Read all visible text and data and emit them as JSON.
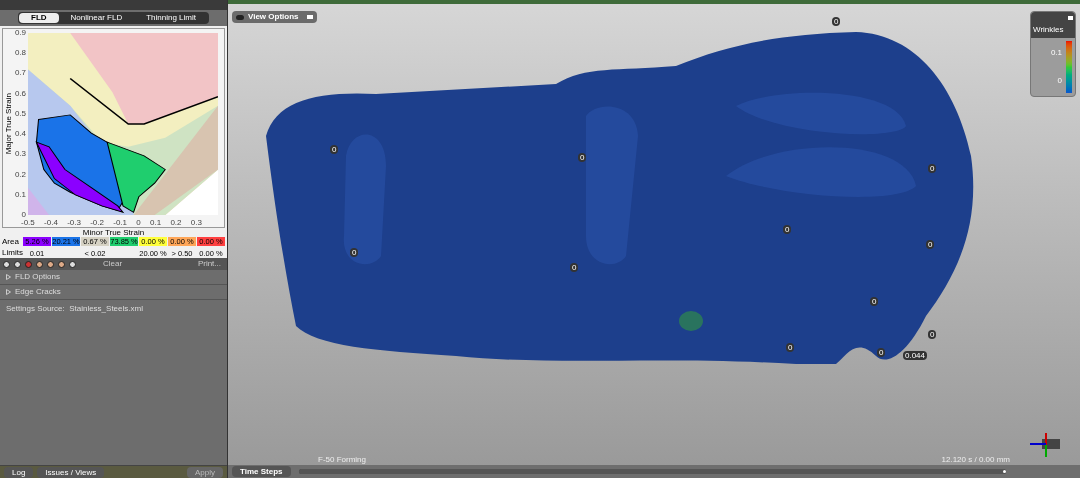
{
  "fld_panel": {
    "tabs": [
      {
        "label": "FLD",
        "selected": true
      },
      {
        "label": "Nonlinear FLD",
        "selected": false
      },
      {
        "label": "Thinning Limit",
        "selected": false
      }
    ],
    "y_axis_label": "Major True Strain",
    "x_axis_label": "Minor True Strain",
    "y_ticks": [
      "0.9",
      "0.8",
      "0.7",
      "0.6",
      "0.5",
      "0.4",
      "0.3",
      "0.2",
      "0.1",
      "0"
    ],
    "x_ticks": [
      "-0.5",
      "-0.4",
      "-0.3",
      "-0.2",
      "-0.1",
      "0",
      "0.1",
      "0.2",
      "0.3"
    ],
    "area_label": "Area",
    "limits_label": "Limits",
    "zones": [
      {
        "area": "5.26 %",
        "limit": "0.01",
        "color": "#8b00ff"
      },
      {
        "area": "20.21 %",
        "color": "#1a73e8"
      },
      {
        "area": "0.67 %",
        "limit": "< 0.02",
        "color": "#d6d2c4"
      },
      {
        "area": "73.85 %",
        "color": "#1fce6e"
      },
      {
        "area": "0.00 %",
        "limit": "20.00 %",
        "color": "#ffff3a"
      },
      {
        "area": "0.00 %",
        "limit": "> 0.50",
        "color": "#ffa658"
      },
      {
        "area": "0.00 %",
        "limit": "0.00 %",
        "color": "#ff4040"
      }
    ],
    "clear_button": "Clear",
    "print_button": "Print...",
    "sections": [
      {
        "label": "FLD Options",
        "expanded": false
      },
      {
        "label": "Edge Cracks",
        "expanded": false
      }
    ],
    "settings_source": "Settings Source:  Stainless_Steels.xml"
  },
  "bottom_bar": {
    "log_button": "Log",
    "issues_button": "Issues / Views",
    "apply_button": "Apply"
  },
  "viewport": {
    "view_options": "View Options",
    "legend": {
      "title": "Wrinkles",
      "max": "0.1",
      "min": "0"
    },
    "markers": [
      "0",
      "0",
      "0",
      "0",
      "0",
      "0",
      "0",
      "0",
      "0",
      "0",
      "0",
      "0",
      "0.044"
    ],
    "time_steps": "Time Steps",
    "step_name": "F-50 Forming",
    "time_reading": "12.120 s / 0.00 mm",
    "level": 1
  }
}
